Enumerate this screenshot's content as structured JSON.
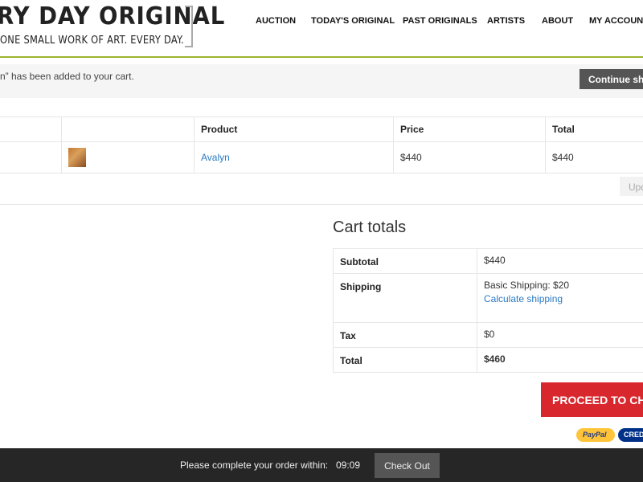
{
  "header": {
    "logo_title": "RY DAY ORIGINAL",
    "logo_tagline": "ONE SMALL WORK OF ART. EVERY DAY.",
    "nav": [
      "AUCTION",
      "TODAY'S ORIGINAL",
      "PAST ORIGINALS",
      "ARTISTS",
      "ABOUT",
      "MY ACCOUNT"
    ]
  },
  "notice": {
    "text": "n” has been added to your cart.",
    "continue_label": "Continue sho"
  },
  "cart": {
    "headers": [
      "",
      "",
      "Product",
      "Price",
      "Total"
    ],
    "rows": [
      {
        "product": "Avalyn",
        "price": "$440",
        "total": "$440"
      }
    ],
    "update_label": "Upd"
  },
  "totals": {
    "title": "Cart totals",
    "subtotal_label": "Subtotal",
    "subtotal": "$440",
    "shipping_label": "Shipping",
    "shipping": "Basic Shipping: $20",
    "calc_shipping": "Calculate shipping",
    "tax_label": "Tax",
    "tax": "$0",
    "total_label": "Total",
    "total": "$460"
  },
  "proceed_label": "PROCEED TO CHE",
  "payment": {
    "paypal": "PayPal",
    "credit": "CRED"
  },
  "footer": {
    "message": "Please complete your order within:",
    "timer": "09:09",
    "checkout_label": "Check Out"
  },
  "colors": {
    "accent_green": "#9cb52d",
    "proceed_red": "#d9272e",
    "link": "#2a7ac2"
  }
}
